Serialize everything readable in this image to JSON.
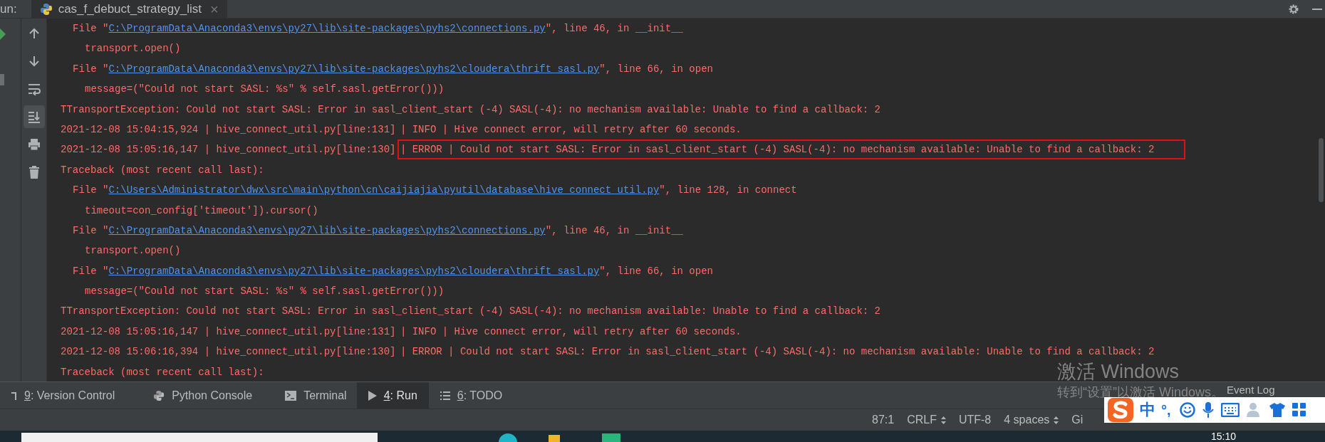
{
  "run_panel": {
    "label": "un:",
    "tab": {
      "title": "cas_f_debuct_strategy_list",
      "close": "×"
    }
  },
  "toolbar": [
    {
      "kind": "up",
      "selected": false
    },
    {
      "kind": "down",
      "selected": false
    },
    {
      "kind": "wrap",
      "selected": false
    },
    {
      "kind": "scroll-end",
      "selected": true
    },
    {
      "kind": "print",
      "selected": false
    },
    {
      "kind": "trash",
      "selected": false
    }
  ],
  "console": {
    "lines": [
      {
        "kind": "file",
        "prefix": "File \"",
        "path": "C:\\ProgramData\\Anaconda3\\envs\\py27\\lib\\site-packages\\pyhs2\\connections.py",
        "suffix": "\", line 46, in __init__"
      },
      {
        "kind": "code",
        "text": "transport.open()"
      },
      {
        "kind": "file",
        "prefix": "File \"",
        "path": "C:\\ProgramData\\Anaconda3\\envs\\py27\\lib\\site-packages\\pyhs2\\cloudera\\thrift_sasl.py",
        "suffix": "\", line 66, in open"
      },
      {
        "kind": "code",
        "text": "message=(\"Could not start SASL: %s\" % self.sasl.getError()))"
      },
      {
        "kind": "plain",
        "text": "TTransportException: Could not start SASL: Error in sasl_client_start (-4) SASL(-4): no mechanism available: Unable to find a callback: 2"
      },
      {
        "kind": "log",
        "head": "2021-12-08 15:04:15,924 | hive_connect_util.py[line:131]",
        "tail": "| INFO | Hive connect error, will retry after 60 seconds.",
        "highlighted": false
      },
      {
        "kind": "log",
        "head": "2021-12-08 15:05:16,147 | hive_connect_util.py[line:130]",
        "tail": "| ERROR | Could not start SASL: Error in sasl_client_start (-4) SASL(-4): no mechanism available: Unable to find a callback: 2",
        "highlighted": true
      },
      {
        "kind": "plain",
        "text": "Traceback (most recent call last):"
      },
      {
        "kind": "file",
        "prefix": "File \"",
        "path": "C:\\Users\\Administrator\\dwx\\src\\main\\python\\cn\\caijiajia\\pyutil\\database\\hive_connect_util.py",
        "suffix": "\", line 128, in connect"
      },
      {
        "kind": "code",
        "text": "timeout=con_config['timeout']).cursor()"
      },
      {
        "kind": "file",
        "prefix": "File \"",
        "path": "C:\\ProgramData\\Anaconda3\\envs\\py27\\lib\\site-packages\\pyhs2\\connections.py",
        "suffix": "\", line 46, in __init__"
      },
      {
        "kind": "code",
        "text": "transport.open()"
      },
      {
        "kind": "file",
        "prefix": "File \"",
        "path": "C:\\ProgramData\\Anaconda3\\envs\\py27\\lib\\site-packages\\pyhs2\\cloudera\\thrift_sasl.py",
        "suffix": "\", line 66, in open"
      },
      {
        "kind": "code",
        "text": "message=(\"Could not start SASL: %s\" % self.sasl.getError()))"
      },
      {
        "kind": "plain",
        "text": "TTransportException: Could not start SASL: Error in sasl_client_start (-4) SASL(-4): no mechanism available: Unable to find a callback: 2"
      },
      {
        "kind": "log",
        "head": "2021-12-08 15:05:16,147 | hive_connect_util.py[line:131]",
        "tail": "| INFO | Hive connect error, will retry after 60 seconds.",
        "highlighted": false
      },
      {
        "kind": "log",
        "head": "2021-12-08 15:06:16,394 | hive_connect_util.py[line:130]",
        "tail": "| ERROR | Could not start SASL: Error in sasl_client_start (-4) SASL(-4): no mechanism available: Unable to find a callback: 2",
        "highlighted": false
      },
      {
        "kind": "plain",
        "text": "Traceback (most recent call last):"
      }
    ]
  },
  "tool_windows": [
    {
      "kind": "vcs",
      "key": "9",
      "label": ": Version Control",
      "selected": false
    },
    {
      "kind": "python",
      "label": "Python Console",
      "selected": false
    },
    {
      "kind": "terminal",
      "label": "Terminal",
      "selected": false
    },
    {
      "kind": "run",
      "key": "4",
      "label": ": Run",
      "selected": true
    },
    {
      "kind": "todo",
      "key": "6",
      "label": ": TODO",
      "selected": false
    }
  ],
  "event_log": "Event Log",
  "status_bar": [
    {
      "text": "87:1",
      "arrows": false
    },
    {
      "text": "CRLF",
      "arrows": true
    },
    {
      "text": "UTF-8",
      "arrows": false
    },
    {
      "text": "4 spaces",
      "arrows": true
    },
    {
      "text": "Gi",
      "arrows": false
    }
  ],
  "activation_notice": {
    "title": "激活 Windows",
    "subtitle": "转到“设置”以激活 Windows。"
  },
  "ime_bar": {
    "mode": "中",
    "punctuation": "°,"
  },
  "taskbar": {
    "clock": "15:10"
  }
}
